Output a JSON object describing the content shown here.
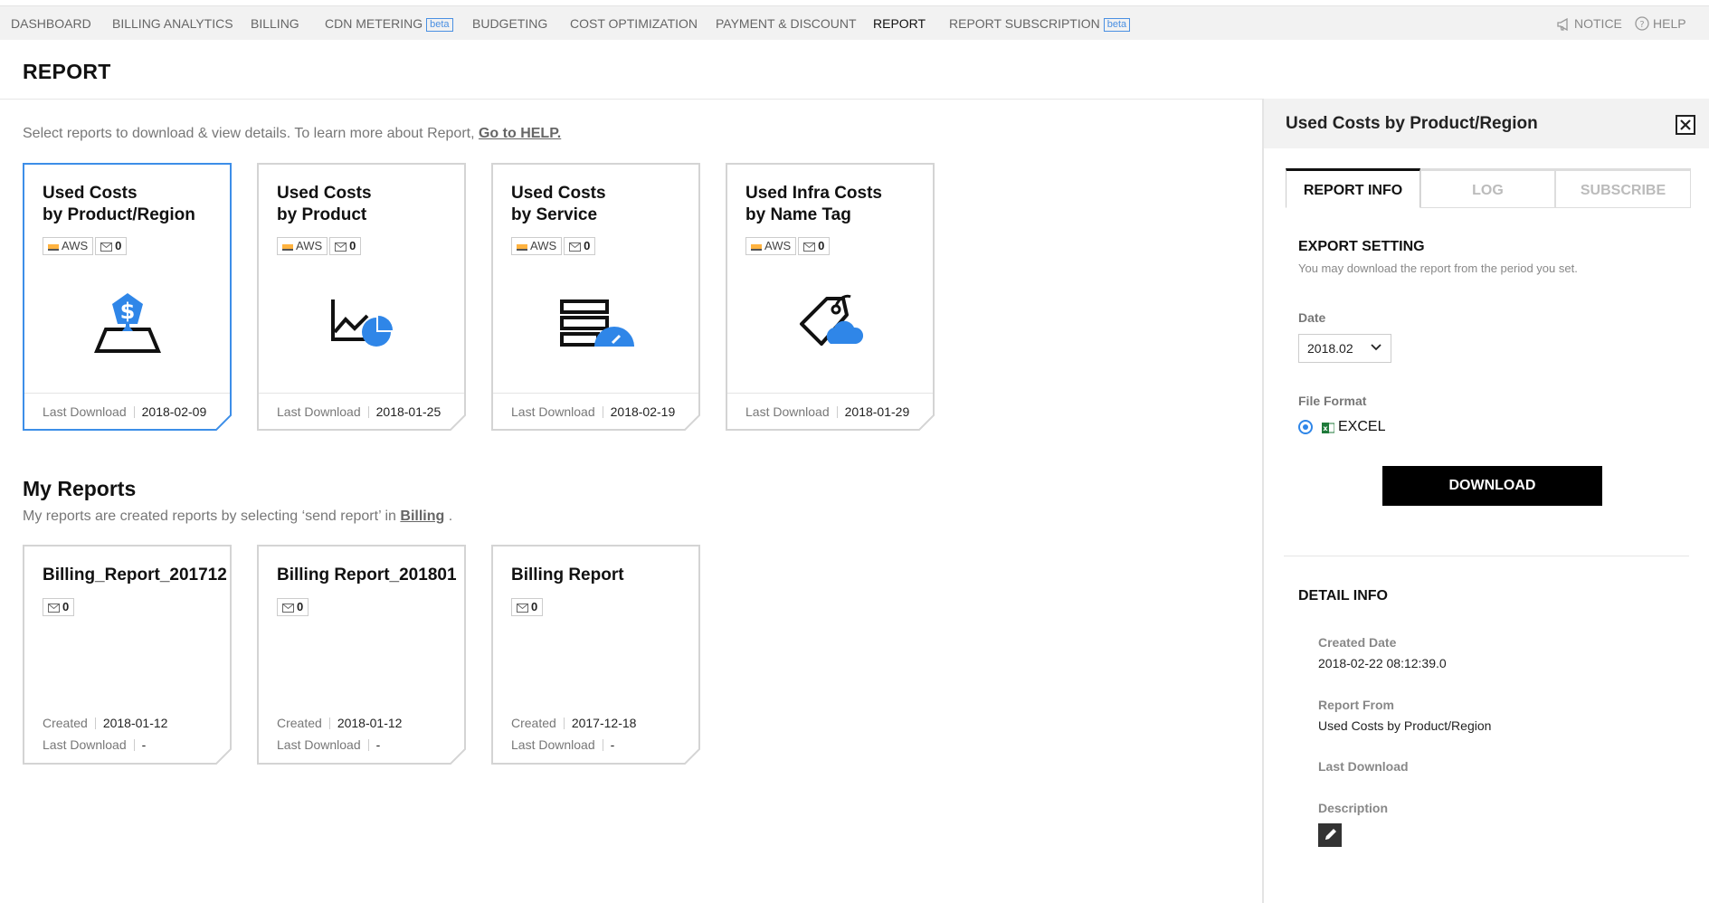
{
  "nav": {
    "items": [
      {
        "label": "DASHBOARD"
      },
      {
        "label": "BILLING ANALYTICS"
      },
      {
        "label": "BILLING"
      },
      {
        "label": "CDN METERING",
        "badge": "beta"
      },
      {
        "label": "BUDGETING"
      },
      {
        "label": "COST OPTIMIZATION"
      },
      {
        "label": "PAYMENT & DISCOUNT"
      },
      {
        "label": "REPORT",
        "active": true
      },
      {
        "label": "REPORT SUBSCRIPTION",
        "badge": "beta"
      }
    ],
    "notice": "NOTICE",
    "help": "HELP"
  },
  "page": {
    "title": "REPORT",
    "intro": "Select reports to download & view details. To learn more about Report,",
    "intro_link": "Go to HELP."
  },
  "reports": [
    {
      "title_line1": "Used Costs",
      "title_line2": "by Product/Region",
      "cloud": "AWS",
      "mail_count": "0",
      "last_download_label": "Last Download",
      "last_download": "2018-02-09",
      "icon": "map-dollar-icon",
      "selected": true
    },
    {
      "title_line1": "Used Costs",
      "title_line2": "by Product",
      "cloud": "AWS",
      "mail_count": "0",
      "last_download_label": "Last Download",
      "last_download": "2018-01-25",
      "icon": "chart-pie-icon"
    },
    {
      "title_line1": "Used Costs",
      "title_line2": "by Service",
      "cloud": "AWS",
      "mail_count": "0",
      "last_download_label": "Last Download",
      "last_download": "2018-02-19",
      "icon": "server-gauge-icon"
    },
    {
      "title_line1": "Used Infra Costs",
      "title_line2": "by Name Tag",
      "cloud": "AWS",
      "mail_count": "0",
      "last_download_label": "Last Download",
      "last_download": "2018-01-29",
      "icon": "tag-cloud-icon"
    }
  ],
  "my_reports": {
    "title": "My Reports",
    "subtitle": "My reports are created reports by selecting ‘send report’ in",
    "subtitle_link": "Billing",
    "subtitle_end": ".",
    "items": [
      {
        "title": "Billing_Report_201712",
        "mail_count": "0",
        "created_label": "Created",
        "created": "2018-01-12",
        "last_download_label": "Last Download",
        "last_download": "-"
      },
      {
        "title": "Billing Report_201801",
        "mail_count": "0",
        "created_label": "Created",
        "created": "2018-01-12",
        "last_download_label": "Last Download",
        "last_download": "-"
      },
      {
        "title": "Billing Report",
        "mail_count": "0",
        "created_label": "Created",
        "created": "2017-12-18",
        "last_download_label": "Last Download",
        "last_download": "-"
      }
    ]
  },
  "panel": {
    "title": "Used Costs by Product/Region",
    "tabs": [
      {
        "label": "REPORT INFO",
        "active": true
      },
      {
        "label": "LOG"
      },
      {
        "label": "SUBSCRIBE"
      }
    ],
    "export": {
      "title": "EXPORT SETTING",
      "subtitle": "You may download the report from the period you set.",
      "date_label": "Date",
      "date_value": "2018.02",
      "format_label": "File Format",
      "format_value": "EXCEL",
      "download_label": "DOWNLOAD"
    },
    "detail": {
      "title": "DETAIL INFO",
      "created_label": "Created Date",
      "created_value": "2018-02-22 08:12:39.0",
      "from_label": "Report From",
      "from_value": "Used Costs by Product/Region",
      "last_download_label": "Last Download",
      "last_download_value": "",
      "description_label": "Description"
    }
  },
  "colors": {
    "accent": "#2f86e8",
    "selected_border": "#3d8ee8",
    "button": "#000000"
  }
}
